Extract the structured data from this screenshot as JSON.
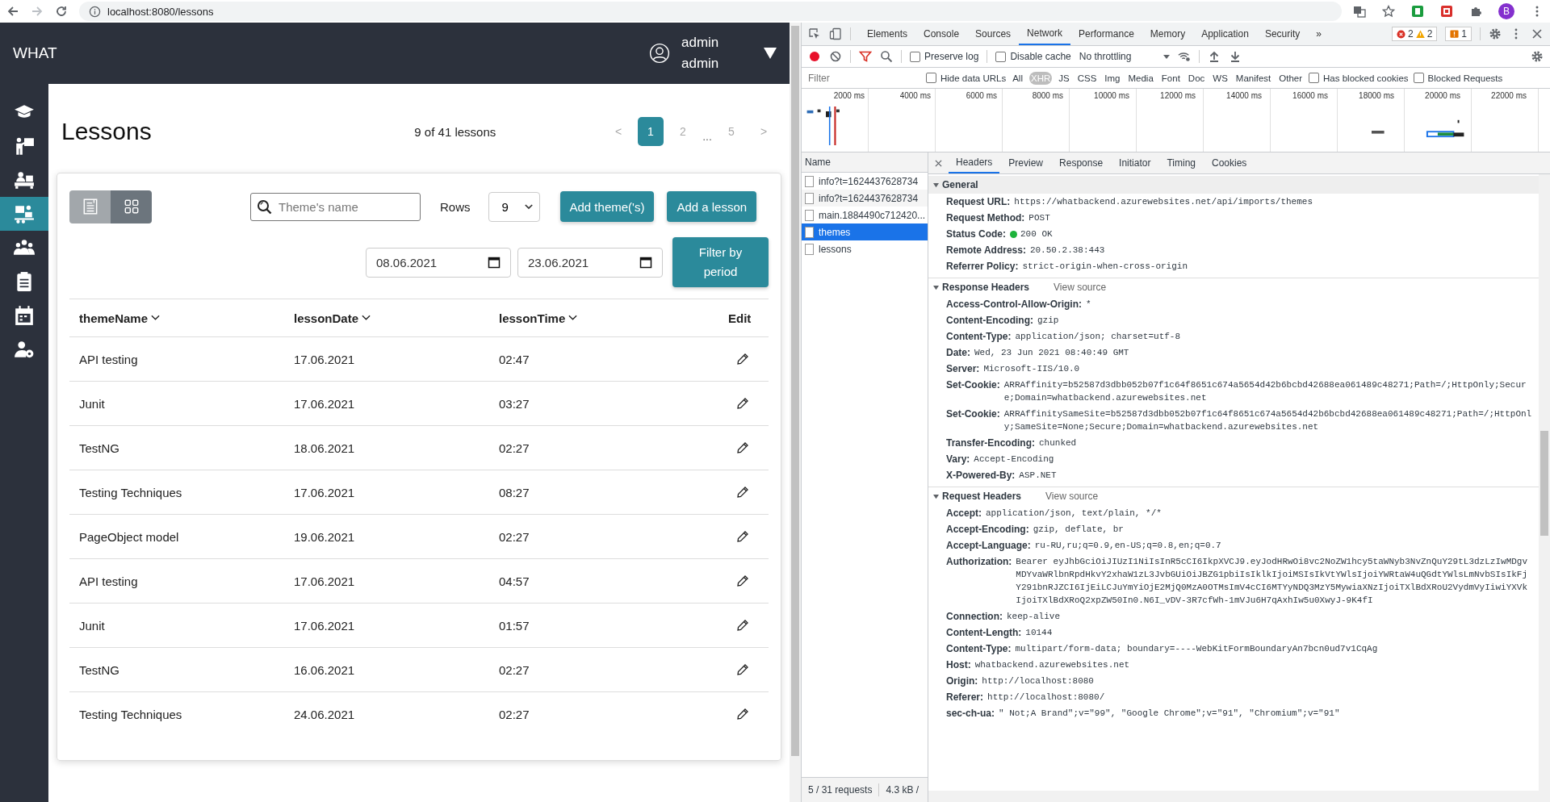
{
  "browser": {
    "url": "localhost:8080/lessons",
    "profile": "B"
  },
  "app": {
    "brand": "WHAT",
    "user_lines": [
      "admin",
      "admin"
    ]
  },
  "sidebar": {
    "items": [
      {
        "selected": false
      },
      {
        "selected": false
      },
      {
        "selected": false
      },
      {
        "selected": true
      },
      {
        "selected": false
      },
      {
        "selected": false
      },
      {
        "selected": false
      },
      {
        "selected": false
      }
    ]
  },
  "page": {
    "title": "Lessons",
    "count": "9 of 41 lessons"
  },
  "pagination": [
    {
      "label": "<",
      "kind": "arrow",
      "selected": false
    },
    {
      "label": "1",
      "kind": "page",
      "selected": true
    },
    {
      "label": "2",
      "kind": "page",
      "selected": false
    },
    {
      "label": "...",
      "kind": "ellipsis",
      "selected": false
    },
    {
      "label": "5",
      "kind": "page",
      "selected": false
    },
    {
      "label": ">",
      "kind": "arrow",
      "selected": false
    }
  ],
  "view_toggle": [
    {
      "kind": "list",
      "selected": true
    },
    {
      "kind": "grid",
      "selected": false
    }
  ],
  "search": {
    "placeholder": "Theme's name"
  },
  "rows_select": {
    "label": "Rows",
    "value": "9"
  },
  "buttons": [
    "Add theme('s)",
    "Add a lesson"
  ],
  "dates": [
    "08.06.2021",
    "23.06.2021"
  ],
  "filter_button": "Filter by period",
  "table": {
    "columns": [
      {
        "label": "themeName",
        "sortable": true
      },
      {
        "label": "lessonDate",
        "sortable": true
      },
      {
        "label": "lessonTime",
        "sortable": true
      },
      {
        "label": "Edit",
        "sortable": false
      }
    ],
    "rows": [
      [
        "API testing",
        "17.06.2021",
        "02:47"
      ],
      [
        "Junit",
        "17.06.2021",
        "03:27"
      ],
      [
        "TestNG",
        "18.06.2021",
        "02:27"
      ],
      [
        "Testing Techniques",
        "17.06.2021",
        "08:27"
      ],
      [
        "PageObject model",
        "19.06.2021",
        "02:27"
      ],
      [
        "API testing",
        "17.06.2021",
        "04:57"
      ],
      [
        "Junit",
        "17.06.2021",
        "01:57"
      ],
      [
        "TestNG",
        "16.06.2021",
        "02:27"
      ],
      [
        "Testing Techniques",
        "24.06.2021",
        "02:27"
      ]
    ]
  },
  "devtools": {
    "tabs": [
      {
        "label": "Elements",
        "selected": false
      },
      {
        "label": "Console",
        "selected": false
      },
      {
        "label": "Sources",
        "selected": false
      },
      {
        "label": "Network",
        "selected": true
      },
      {
        "label": "Performance",
        "selected": false
      },
      {
        "label": "Memory",
        "selected": false
      },
      {
        "label": "Application",
        "selected": false
      },
      {
        "label": "Security",
        "selected": false
      }
    ],
    "more": "»",
    "badges": {
      "errors": "2",
      "warnings": "2",
      "issues": "1"
    },
    "toolbar": {
      "recording": true,
      "filter_active": true,
      "preserve_log": {
        "label": "Preserve log",
        "checked": false
      },
      "disable_cache": {
        "label": "Disable cache",
        "checked": false
      },
      "throttling": "No throttling"
    },
    "filter": {
      "placeholder": "Filter",
      "hide_data_urls": {
        "label": "Hide data URLs",
        "checked": false
      },
      "types": [
        {
          "label": "All",
          "selected": false
        },
        {
          "label": "XHR",
          "selected": true
        },
        {
          "label": "JS",
          "selected": false
        },
        {
          "label": "CSS",
          "selected": false
        },
        {
          "label": "Img",
          "selected": false
        },
        {
          "label": "Media",
          "selected": false
        },
        {
          "label": "Font",
          "selected": false
        },
        {
          "label": "Doc",
          "selected": false
        },
        {
          "label": "WS",
          "selected": false
        },
        {
          "label": "Manifest",
          "selected": false
        },
        {
          "label": "Other",
          "selected": false
        }
      ],
      "has_blocked_cookies": {
        "label": "Has blocked cookies",
        "checked": false
      },
      "blocked_requests": {
        "label": "Blocked Requests",
        "checked": false
      }
    },
    "timeline": {
      "ticks": [
        "2000 ms",
        "4000 ms",
        "6000 ms",
        "8000 ms",
        "10000 ms",
        "12000 ms",
        "14000 ms",
        "16000 ms",
        "18000 ms",
        "20000 ms",
        "22000 ms"
      ]
    },
    "requests": {
      "header": "Name",
      "items": [
        {
          "name": "info?t=1624437628734",
          "selected": false
        },
        {
          "name": "info?t=1624437628734",
          "selected": false
        },
        {
          "name": "main.1884490c712420...",
          "selected": false
        },
        {
          "name": "themes",
          "selected": true
        },
        {
          "name": "lessons",
          "selected": false
        }
      ]
    },
    "footer": {
      "count": "5 / 31 requests",
      "size": "4.3 kB /"
    },
    "detail_tabs": [
      {
        "label": "Headers",
        "selected": true
      },
      {
        "label": "Preview",
        "selected": false
      },
      {
        "label": "Response",
        "selected": false
      },
      {
        "label": "Initiator",
        "selected": false
      },
      {
        "label": "Timing",
        "selected": false
      },
      {
        "label": "Cookies",
        "selected": false
      }
    ],
    "sections": [
      {
        "title": "General",
        "expanded": true,
        "rows": [
          {
            "key": "Request URL:",
            "value": "https://whatbackend.azurewebsites.net/api/imports/themes",
            "kind": "text"
          },
          {
            "key": "Request Method:",
            "value": "POST",
            "kind": "text"
          },
          {
            "key": "Status Code:",
            "value": "200 OK",
            "kind": "status"
          },
          {
            "key": "Remote Address:",
            "value": "20.50.2.38:443",
            "kind": "text"
          },
          {
            "key": "Referrer Policy:",
            "value": "strict-origin-when-cross-origin",
            "kind": "text"
          }
        ]
      },
      {
        "title": "Response Headers",
        "action": "View source",
        "expanded": true,
        "rows": [
          {
            "key": "Access-Control-Allow-Origin:",
            "value": "*",
            "kind": "text"
          },
          {
            "key": "Content-Encoding:",
            "value": "gzip",
            "kind": "text"
          },
          {
            "key": "Content-Type:",
            "value": "application/json; charset=utf-8",
            "kind": "text"
          },
          {
            "key": "Date:",
            "value": "Wed, 23 Jun 2021 08:40:49 GMT",
            "kind": "text"
          },
          {
            "key": "Server:",
            "value": "Microsoft-IIS/10.0",
            "kind": "text"
          },
          {
            "key": "Set-Cookie:",
            "value": "ARRAffinity=b52587d3dbb052b07f1c64f8651c674a5654d42b6bcbd42688ea061489c48271;Path=/;HttpOnly;Secure;Domain=whatbackend.azurewebsites.net",
            "kind": "text"
          },
          {
            "key": "Set-Cookie:",
            "value": "ARRAffinitySameSite=b52587d3dbb052b07f1c64f8651c674a5654d42b6bcbd42688ea061489c48271;Path=/;HttpOnly;SameSite=None;Secure;Domain=whatbackend.azurewebsites.net",
            "kind": "text"
          },
          {
            "key": "Transfer-Encoding:",
            "value": "chunked",
            "kind": "text"
          },
          {
            "key": "Vary:",
            "value": "Accept-Encoding",
            "kind": "text"
          },
          {
            "key": "X-Powered-By:",
            "value": "ASP.NET",
            "kind": "text"
          }
        ]
      },
      {
        "title": "Request Headers",
        "action": "View source",
        "expanded": true,
        "rows": [
          {
            "key": "Accept:",
            "value": "application/json, text/plain, */*",
            "kind": "text"
          },
          {
            "key": "Accept-Encoding:",
            "value": "gzip, deflate, br",
            "kind": "text"
          },
          {
            "key": "Accept-Language:",
            "value": "ru-RU,ru;q=0.9,en-US;q=0.8,en;q=0.7",
            "kind": "text"
          },
          {
            "key": "Authorization:",
            "value": "Bearer eyJhbGciOiJIUzI1NiIsInR5cCI6IkpXVCJ9.eyJodHRwOi8vc2NoZW1hcy5taWNyb3NvZnQuY29tL3dzLzIwMDgvMDYvaWRlbnRpdHkvY2xhaW1zL3JvbGUiOiJBZG1pbiIsIklkIjoiMSIsIkVtYWlsIjoiYWRtaW4uQGdtYWlsLmNvbSIsIkFjY291bnRJZCI6IjEiLCJuYmYiOjE2MjQ0MzA0OTMsImV4cCI6MTYyNDQ3MzY5MywiaXNzIjoiTXlBdXRoU2VydmVyIiwiYXVkIjoiTXlBdXRoQ2xpZW50In0.N6I_vDV-3R7cfWh-1mVJu6H7qAxhIw5u0XwyJ-9K4fI",
            "kind": "text"
          },
          {
            "key": "Connection:",
            "value": "keep-alive",
            "kind": "text"
          },
          {
            "key": "Content-Length:",
            "value": "10144",
            "kind": "text"
          },
          {
            "key": "Content-Type:",
            "value": "multipart/form-data; boundary=----WebKitFormBoundaryAn7bcn0ud7v1CqAg",
            "kind": "text"
          },
          {
            "key": "Host:",
            "value": "whatbackend.azurewebsites.net",
            "kind": "text"
          },
          {
            "key": "Origin:",
            "value": "http://localhost:8080",
            "kind": "text"
          },
          {
            "key": "Referer:",
            "value": "http://localhost:8080/",
            "kind": "text"
          },
          {
            "key": "sec-ch-ua:",
            "value": "\" Not;A Brand\";v=\"99\", \"Google Chrome\";v=\"91\", \"Chromium\";v=\"91\"",
            "kind": "text"
          }
        ]
      }
    ]
  }
}
